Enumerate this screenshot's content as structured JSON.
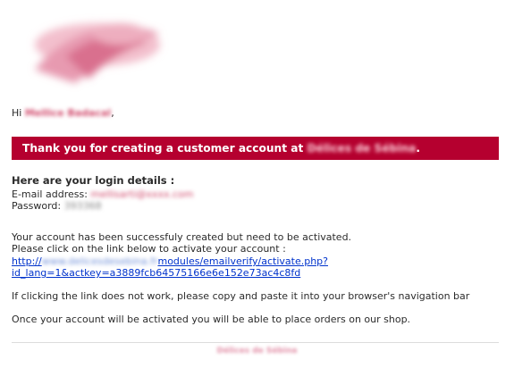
{
  "email": {
    "greeting_prefix": "Hi",
    "customer_name": "Mellice Badacal",
    "greeting_suffix": ",",
    "banner_text": "Thank you for creating a customer account at",
    "shop_name": "Délices de Sébina",
    "banner_suffix": ".",
    "login_title": "Here are your login details :",
    "email_label": "E-mail address:",
    "email_value": "mellisarti@xxxx.com",
    "password_label": "Password:",
    "password_value": "393368",
    "message_line1": "Your account has been successfuly created but need to be activated.",
    "message_line2": "Please click on the link below to activate your account :",
    "link_prefix": "http://",
    "link_host": "www.delicesdesebina.fr",
    "link_path": "modules/emailverify/activate.php?",
    "link_line2": "id_lang=1&actkey=a3889fcb64575166e6e152e73ac4c8fd",
    "help_text": "If clicking the link does not work, please copy and paste it into your browser's navigation bar",
    "closing_text": "Once your account will be activated you will be able to place orders on our shop.",
    "footer_shop_name": "Délices de Sébina"
  },
  "colors": {
    "banner_bg": "#b5002f",
    "link": "#0033cc",
    "blurred_accent": "#d14a6c"
  },
  "icons": {
    "logo": "shop-logo-blurred"
  }
}
